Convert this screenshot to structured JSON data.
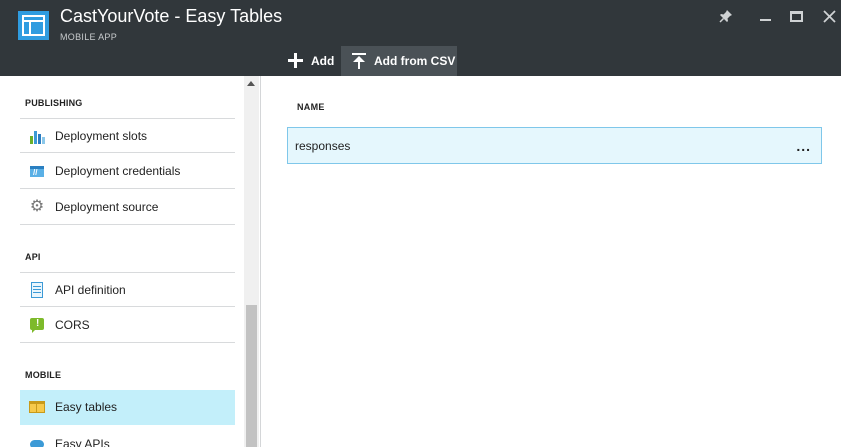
{
  "header": {
    "title": "CastYourVote - Easy Tables",
    "subtitle": "MOBILE APP",
    "window_controls": [
      "pin-icon",
      "minimize-icon",
      "maximize-icon",
      "close-icon"
    ]
  },
  "commands": {
    "add_label": "Add",
    "add_icon": "plus-icon",
    "csv_label": "Add from CSV",
    "csv_icon": "upload-icon"
  },
  "sidebar": {
    "sections": [
      {
        "label": "PUBLISHING",
        "items": [
          {
            "label": "Deployment slots",
            "icon": "deployment-slots-icon"
          },
          {
            "label": "Deployment credentials",
            "icon": "deployment-credentials-icon"
          },
          {
            "label": "Deployment source",
            "icon": "gear-icon"
          }
        ]
      },
      {
        "label": "API",
        "items": [
          {
            "label": "API definition",
            "icon": "api-definition-icon"
          },
          {
            "label": "CORS",
            "icon": "cors-icon"
          }
        ]
      },
      {
        "label": "MOBILE",
        "items": [
          {
            "label": "Easy tables",
            "icon": "table-icon",
            "selected": true
          },
          {
            "label": "Easy APIs",
            "icon": "cloud-icon"
          }
        ]
      }
    ]
  },
  "main": {
    "column_header": "NAME",
    "rows": [
      {
        "name": "responses",
        "more": "..."
      }
    ]
  },
  "colors": {
    "header_bg": "#31373b",
    "command_active_bg": "#4a5156",
    "accent_tile": "#2f9ce0",
    "selected_item_bg": "#c3effa",
    "row_bg": "#e5f7fd",
    "row_border": "#7fc7ea"
  }
}
